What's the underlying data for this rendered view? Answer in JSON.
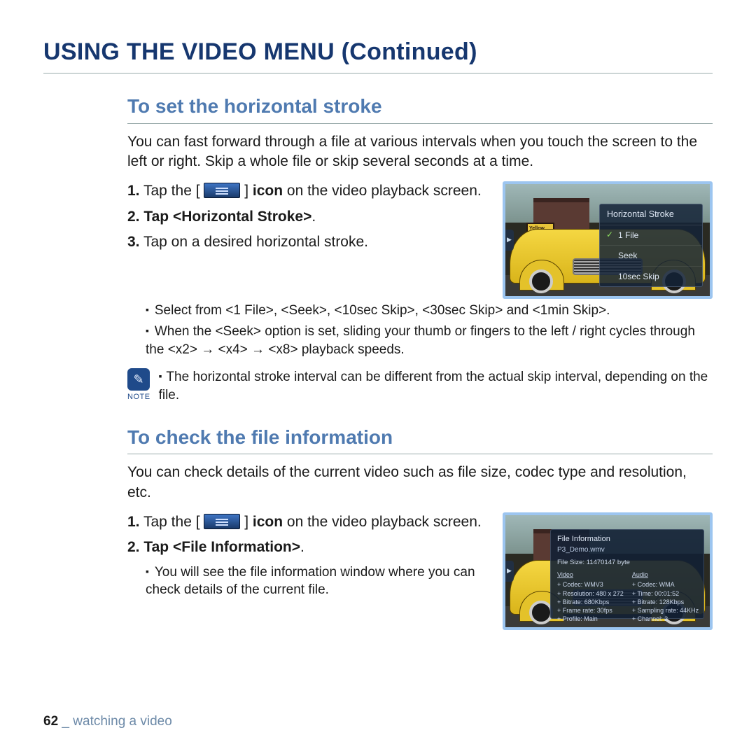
{
  "page_title": "USING THE VIDEO MENU (Continued)",
  "section1": {
    "title": "To set the horizontal stroke",
    "lead": "You can fast forward through a file at various intervals when you touch the screen to the left or right. Skip a whole file or skip several seconds at a time.",
    "step1_a": "Tap the [ ",
    "step1_b": " ] ",
    "step1_icon_bold": "icon",
    "step1_c": " on the video playback screen.",
    "step2_a": "Tap ",
    "step2_b": "<Horizontal Stroke>",
    "step2_c": ".",
    "step3": "Tap on a desired horizontal stroke.",
    "bul1": "Select from <1 File>, <Seek>, <10sec Skip>, <30sec Skip> and <1min Skip>.",
    "bul2": "When the <Seek> option is set, sliding your thumb or fingers to the left / right cycles through the <x2> → <x4> → <x8> playback speeds.",
    "note_label": "NOTE",
    "note_text": "The horizontal stroke interval can be different from the actual skip interval, depending on the file.",
    "menu": {
      "header": "Horizontal Stroke",
      "item1": "1 File",
      "item2": "Seek",
      "item3": "10sec Skip"
    },
    "sign": "Yellow Cab Co."
  },
  "section2": {
    "title": "To check the file information",
    "lead": "You can check details of the current video such as file size, codec type and resolution, etc.",
    "step1_a": "Tap the [ ",
    "step1_b": " ] ",
    "step1_icon_bold": "icon",
    "step1_c": " on the video playback screen.",
    "step2_a": "Tap ",
    "step2_b": "<File Information>",
    "step2_c": ".",
    "bul1": "You will see the file information window where you can check details of the current file.",
    "info": {
      "header": "File Information",
      "filename": "P3_Demo.wmv",
      "filesize": "File Size: 11470147 byte",
      "video_h": "Video",
      "v1": "+ Codec: WMV3",
      "v2": "+ Resolution: 480 x 272",
      "v3": "+ Bitrate: 680Kbps",
      "v4": "+ Frame rate: 30fps",
      "v5": "+ Profile: Main",
      "audio_h": "Audio",
      "a1": "+ Codec: WMA",
      "a2": "+ Time: 00:01:52",
      "a3": "+ Bitrate: 128Kbps",
      "a4": "+ Sampling rate: 44KHz",
      "a5": "+ Channel: 2"
    }
  },
  "footer": {
    "page": "62",
    "sep": "_",
    "chapter": "watching a video"
  }
}
